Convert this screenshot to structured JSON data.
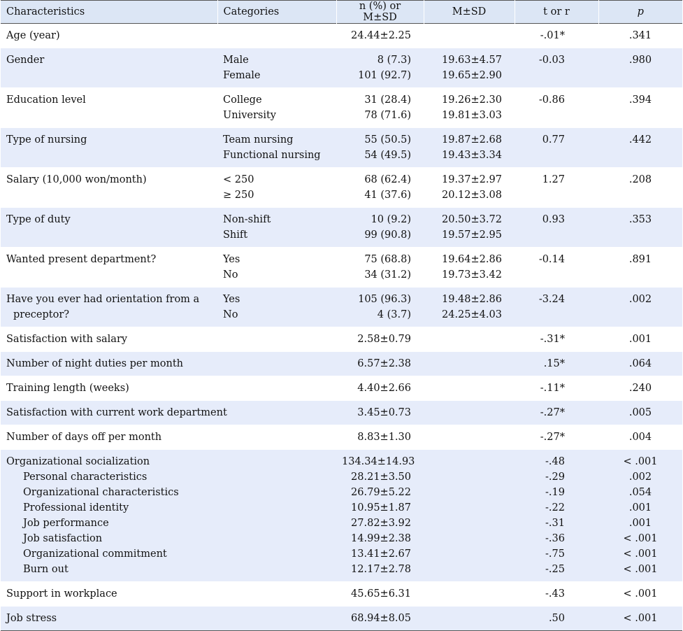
{
  "headers": [
    "Characteristics",
    "Categories",
    "n (%) or M±SD",
    "M±SD",
    "t or r",
    "p"
  ],
  "rows": [
    {
      "char": [
        "Age (year)"
      ],
      "cats": [],
      "n": [
        "24.44±2.25"
      ],
      "msd": [],
      "t": [
        "-.01*"
      ],
      "p": [
        ".341"
      ],
      "shade": false,
      "single": true
    },
    {
      "char": [
        "Gender"
      ],
      "cats": [
        "Male",
        "Female"
      ],
      "n": [
        "8 (7.3)",
        "101 (92.7)"
      ],
      "msd": [
        "19.63±4.57",
        "19.65±2.90"
      ],
      "t": [
        "-0.03"
      ],
      "p": [
        ".980"
      ],
      "shade": true
    },
    {
      "char": [
        "Education level"
      ],
      "cats": [
        "College",
        "University"
      ],
      "n": [
        "31 (28.4)",
        "78 (71.6)"
      ],
      "msd": [
        "19.26±2.30",
        "19.81±3.03"
      ],
      "t": [
        "-0.86"
      ],
      "p": [
        ".394"
      ],
      "shade": false
    },
    {
      "char": [
        "Type of nursing"
      ],
      "cats": [
        "Team nursing",
        "Functional nursing"
      ],
      "n": [
        "55 (50.5)",
        "54 (49.5)"
      ],
      "msd": [
        "19.87±2.68",
        "19.43±3.34"
      ],
      "t": [
        "0.77"
      ],
      "p": [
        ".442"
      ],
      "shade": true
    },
    {
      "char": [
        "Salary (10,000 won/month)"
      ],
      "cats": [
        "< 250",
        "≥ 250"
      ],
      "n": [
        "68 (62.4)",
        "41 (37.6)"
      ],
      "msd": [
        "19.37±2.97",
        "20.12±3.08"
      ],
      "t": [
        "1.27"
      ],
      "p": [
        ".208"
      ],
      "shade": false
    },
    {
      "char": [
        "Type of duty"
      ],
      "cats": [
        "Non-shift",
        "Shift"
      ],
      "n": [
        "10 (9.2)",
        "99 (90.8)"
      ],
      "msd": [
        "20.50±3.72",
        "19.57±2.95"
      ],
      "t": [
        "0.93"
      ],
      "p": [
        ".353"
      ],
      "shade": true
    },
    {
      "char": [
        "Wanted present department?"
      ],
      "cats": [
        "Yes",
        "No"
      ],
      "n": [
        "75 (68.8)",
        "34 (31.2)"
      ],
      "msd": [
        "19.64±2.86",
        "19.73±3.42"
      ],
      "t": [
        "-0.14"
      ],
      "p": [
        ".891"
      ],
      "shade": false
    },
    {
      "char": [
        "Have you ever had orientation from a",
        "preceptor?"
      ],
      "cats": [
        "Yes",
        "No"
      ],
      "n": [
        "105 (96.3)",
        "4 (3.7)"
      ],
      "msd": [
        "19.48±2.86",
        "24.25±4.03"
      ],
      "t": [
        "-3.24"
      ],
      "p": [
        ".002"
      ],
      "shade": true,
      "hang": true
    },
    {
      "char": [
        "Satisfaction with salary"
      ],
      "cats": [],
      "n": [
        "2.58±0.79"
      ],
      "msd": [],
      "t": [
        "-.31*"
      ],
      "p": [
        ".001"
      ],
      "shade": false,
      "single": true
    },
    {
      "char": [
        "Number of night duties per month"
      ],
      "cats": [],
      "n": [
        "6.57±2.38"
      ],
      "msd": [],
      "t": [
        ".15*"
      ],
      "p": [
        ".064"
      ],
      "shade": true,
      "single": true
    },
    {
      "char": [
        "Training length (weeks)"
      ],
      "cats": [],
      "n": [
        "4.40±2.66"
      ],
      "msd": [],
      "t": [
        "-.11*"
      ],
      "p": [
        ".240"
      ],
      "shade": false,
      "single": true
    },
    {
      "char": [
        "Satisfaction with current work department"
      ],
      "cats": [],
      "n": [
        "3.45±0.73"
      ],
      "msd": [],
      "t": [
        "-.27*"
      ],
      "p": [
        ".005"
      ],
      "shade": true,
      "single": true
    },
    {
      "char": [
        "Number of days off per month"
      ],
      "cats": [],
      "n": [
        "8.83±1.30"
      ],
      "msd": [],
      "t": [
        "-.27*"
      ],
      "p": [
        ".004"
      ],
      "shade": false,
      "single": true
    },
    {
      "char": [
        "Organizational socialization",
        "Personal characteristics",
        "Organizational characteristics",
        "Professional identity",
        "Job performance",
        "Job satisfaction",
        "Organizational commitment",
        "Burn out"
      ],
      "cats": [],
      "n": [
        "134.34±14.93",
        "28.21±3.50",
        "26.79±5.22",
        "10.95±1.87",
        "27.82±3.92",
        "14.99±2.38",
        "13.41±2.67",
        "12.17±2.78"
      ],
      "msd": [],
      "t": [
        "-.48",
        "-.29",
        "-.19",
        "-.22",
        "-.31",
        "-.36",
        "-.75",
        "-.25"
      ],
      "p": [
        "< .001",
        ".002",
        ".054",
        ".001",
        ".001",
        "< .001",
        "< .001",
        "< .001"
      ],
      "shade": true,
      "sub": true
    },
    {
      "char": [
        "Support in workplace"
      ],
      "cats": [],
      "n": [
        "45.65±6.31"
      ],
      "msd": [],
      "t": [
        "-.43"
      ],
      "p": [
        "< .001"
      ],
      "shade": false,
      "single": true
    },
    {
      "char": [
        "Job stress"
      ],
      "cats": [],
      "n": [
        "68.94±8.05"
      ],
      "msd": [],
      "t": [
        ".50"
      ],
      "p": [
        "< .001"
      ],
      "shade": true,
      "single": true
    }
  ]
}
